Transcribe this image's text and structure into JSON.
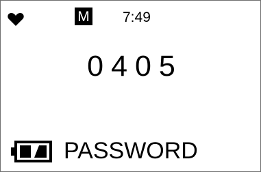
{
  "status_bar": {
    "heart_icon": "heart-icon",
    "mode": "M",
    "time": "7:49"
  },
  "code": {
    "digits": [
      "0",
      "4",
      "0",
      "5"
    ]
  },
  "footer": {
    "battery_icon": "battery-icon",
    "label": "PASSWORD"
  },
  "colors": {
    "background": "#ffffff",
    "foreground": "#000000",
    "border": "#6e6e6e"
  }
}
